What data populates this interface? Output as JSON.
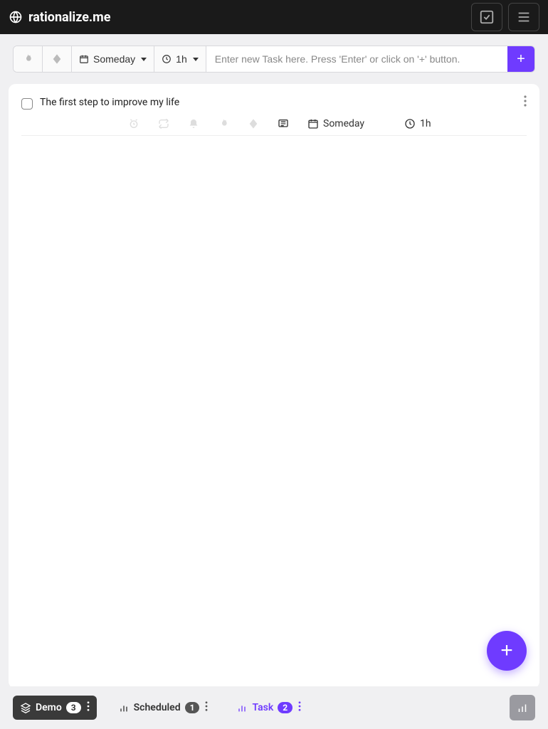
{
  "header": {
    "brand": "rationalize.me"
  },
  "toolbar": {
    "schedule_label": "Someday",
    "duration_label": "1h",
    "input_placeholder": "Enter new Task here. Press 'Enter' or click on '+' button.",
    "add_label": "+"
  },
  "tasks": [
    {
      "title": "The first step to improve my life",
      "schedule": "Someday",
      "duration": "1h"
    }
  ],
  "fab": {
    "label": "+"
  },
  "bottom": {
    "demo": {
      "label": "Demo",
      "count": "3"
    },
    "scheduled": {
      "label": "Scheduled",
      "count": "1"
    },
    "task": {
      "label": "Task",
      "count": "2"
    }
  }
}
